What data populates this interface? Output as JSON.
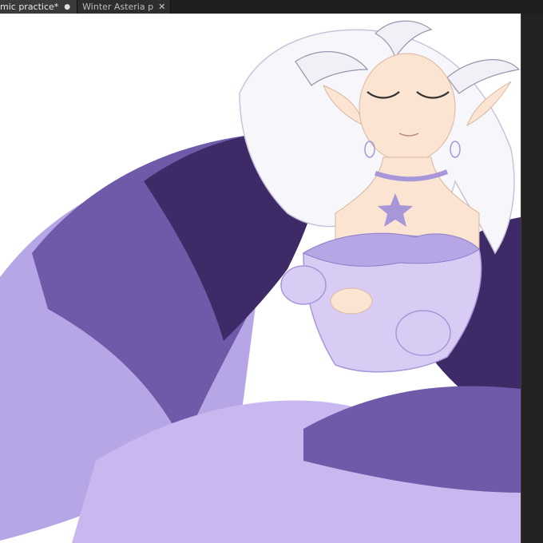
{
  "tabs": [
    {
      "label": "mic practice*",
      "modified_marker": "●",
      "active": true
    },
    {
      "label": "Winter Asteria p",
      "close_glyph": "✕",
      "active": false
    }
  ],
  "colors": {
    "chrome_dark": "#1f1f1f",
    "canvas": "#ffffff",
    "wing_dark": "#3d2a66",
    "wing_mid": "#6e5aa8",
    "wing_light": "#b7a6e6",
    "dress": "#d8ccf5",
    "skin": "#fbe4d2"
  }
}
